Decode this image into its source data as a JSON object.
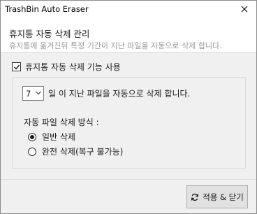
{
  "window": {
    "title": "TrashBin Auto Eraser"
  },
  "header": {
    "title": "휴지통 자동 삭제 관리",
    "description": "휴지통에 옮겨진뒤 특정 기간이 지난 파일을 자동으로 삭제 합니다."
  },
  "enable": {
    "label": "휴지통 자동 삭제 기능 사용",
    "checked": true
  },
  "days": {
    "selected_value": "7",
    "suffix_label": "일 이 지난 파일을 자동으로 삭제 합니다."
  },
  "method": {
    "label": "자동 파일 삭제 방식 :",
    "options": [
      {
        "label": "일반 삭제",
        "selected": true
      },
      {
        "label": "완전 삭제(복구 불가능)",
        "selected": false
      }
    ]
  },
  "footer": {
    "apply_close_label": "적용 & 닫기"
  },
  "icons": {
    "close": "close-icon",
    "refresh": "refresh-icon",
    "chevron": "chevron-down-icon"
  }
}
